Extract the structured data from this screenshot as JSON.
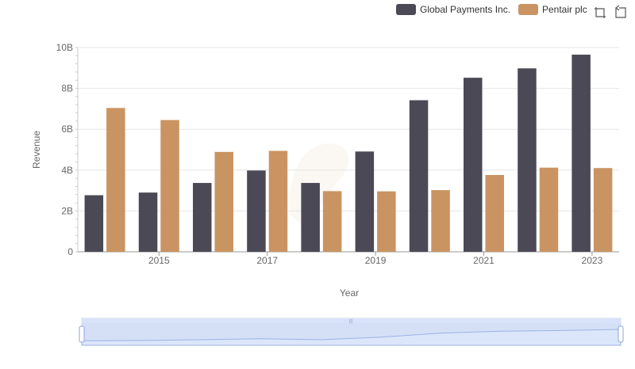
{
  "toolbar": {
    "icons": [
      "zoom-select-icon",
      "zoom-reset-icon"
    ]
  },
  "chart_data": {
    "type": "bar",
    "title": "",
    "xlabel": "Year",
    "ylabel": "Revenue",
    "categories": [
      "2014",
      "2015",
      "2016",
      "2017",
      "2018",
      "2019",
      "2020",
      "2021",
      "2022",
      "2023"
    ],
    "x_tick_labels": [
      "2015",
      "2017",
      "2019",
      "2021",
      "2023"
    ],
    "y_tick_labels": [
      "0",
      "2B",
      "4B",
      "6B",
      "8B",
      "10B"
    ],
    "ylim": [
      0,
      10000000000
    ],
    "grid": true,
    "legend_position": "top-right",
    "series": [
      {
        "name": "Global Payments Inc.",
        "color": "#4a4955",
        "values": [
          2770000000,
          2900000000,
          3370000000,
          3980000000,
          3370000000,
          4910000000,
          7420000000,
          8520000000,
          8980000000,
          9650000000
        ]
      },
      {
        "name": "Pentair plc",
        "color": "#c99462",
        "values": [
          7040000000,
          6450000000,
          4890000000,
          4940000000,
          2970000000,
          2960000000,
          3020000000,
          3760000000,
          4120000000,
          4100000000
        ]
      }
    ]
  }
}
